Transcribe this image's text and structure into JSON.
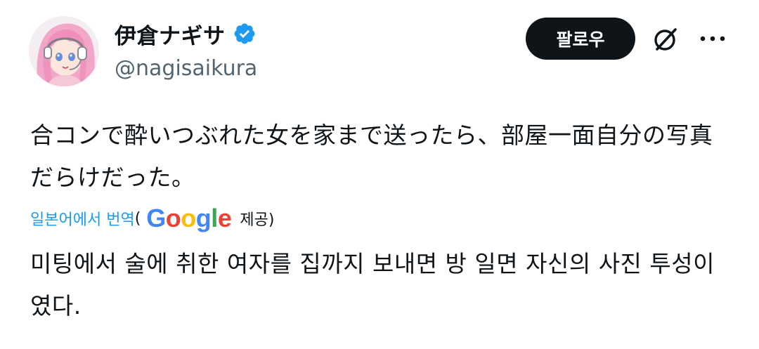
{
  "author": {
    "display_name": "伊倉ナギサ",
    "handle": "@nagisaikura",
    "verified": true
  },
  "actions": {
    "follow_label": "팔로우",
    "grok_icon": "grok-icon",
    "more_icon": "more-icon"
  },
  "tweet": {
    "text": "合コンで酔いつぶれた女を家まで送ったら、部屋一面自分の写真だらけだった。"
  },
  "translation": {
    "link_label": "일본어에서 번역",
    "paren_open": "(",
    "provider_suffix": "제공)",
    "google_letters": [
      "G",
      "o",
      "o",
      "g",
      "l",
      "e"
    ],
    "google_colors": [
      "#4285F4",
      "#EA4335",
      "#FBBC05",
      "#4285F4",
      "#34A853",
      "#EA4335"
    ],
    "text": "미팅에서 술에 취한 여자를 집까지 보내면 방 일면 자신의 사진 투성이였다."
  },
  "colors": {
    "verified_blue": "#1d9bf0",
    "link_blue": "#1d9bf0",
    "follow_bg": "#0f1419",
    "secondary_text": "#536471"
  }
}
